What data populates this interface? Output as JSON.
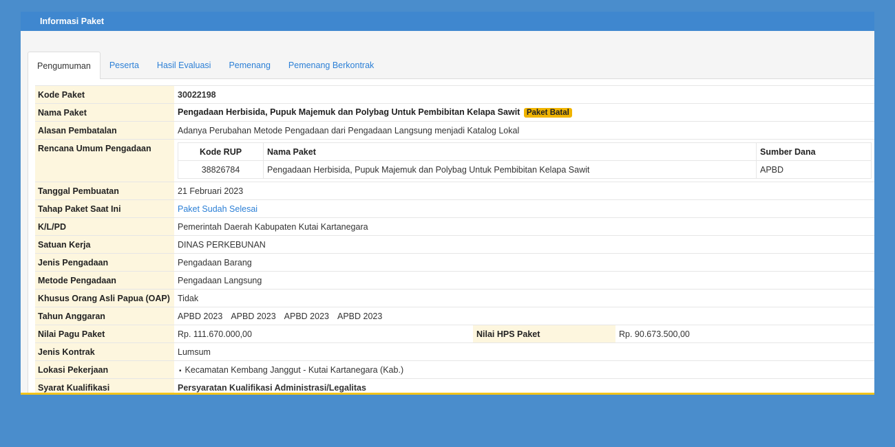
{
  "header": {
    "title": "Informasi Paket"
  },
  "tabs": [
    "Pengumuman",
    "Peserta",
    "Hasil Evaluasi",
    "Pemenang",
    "Pemenang Berkontrak"
  ],
  "rows": {
    "kode_paket": {
      "label": "Kode Paket",
      "value": "30022198"
    },
    "nama_paket": {
      "label": "Nama Paket",
      "value": "Pengadaan Herbisida, Pupuk Majemuk dan Polybag Untuk Pembibitan Kelapa Sawit",
      "badge": "Paket Batal"
    },
    "alasan": {
      "label": "Alasan Pembatalan",
      "value": "Adanya Perubahan Metode Pengadaan dari Pengadaan Langsung menjadi Katalog Lokal"
    },
    "rup": {
      "label": "Rencana Umum Pengadaan",
      "headers": {
        "kode": "Kode RUP",
        "nama": "Nama Paket",
        "sumber": "Sumber Dana"
      },
      "row": {
        "kode": "38826784",
        "nama": "Pengadaan Herbisida, Pupuk Majemuk dan Polybag Untuk Pembibitan Kelapa Sawit",
        "sumber": "APBD"
      }
    },
    "tanggal": {
      "label": "Tanggal Pembuatan",
      "value": "21 Februari 2023"
    },
    "tahap": {
      "label": "Tahap Paket Saat Ini",
      "value": "Paket Sudah Selesai"
    },
    "klpd": {
      "label": "K/L/PD",
      "value": "Pemerintah Daerah Kabupaten Kutai Kartanegara"
    },
    "satker": {
      "label": "Satuan Kerja",
      "value": "DINAS PERKEBUNAN"
    },
    "jenis": {
      "label": "Jenis Pengadaan",
      "value": "Pengadaan Barang"
    },
    "metode": {
      "label": "Metode Pengadaan",
      "value": "Pengadaan Langsung"
    },
    "oap": {
      "label": "Khusus Orang Asli Papua (OAP)",
      "value": "Tidak"
    },
    "tahun": {
      "label": "Tahun Anggaran",
      "values": [
        "APBD 2023",
        "APBD 2023",
        "APBD 2023",
        "APBD 2023"
      ]
    },
    "pagu": {
      "label": "Nilai Pagu Paket",
      "value": "Rp. 111.670.000,00",
      "hps_label": "Nilai HPS Paket",
      "hps_value": "Rp. 90.673.500,00"
    },
    "kontrak": {
      "label": "Jenis Kontrak",
      "value": "Lumsum"
    },
    "lokasi": {
      "label": "Lokasi Pekerjaan",
      "value": "Kecamatan Kembang Janggut - Kutai Kartanegara (Kab.)"
    },
    "syarat": {
      "label": "Syarat Kualifikasi",
      "value": "Persyaratan Kualifikasi Administrasi/Legalitas"
    }
  },
  "colors": {
    "header_blue": "#3f87cf",
    "label_bg": "#fdf6de",
    "badge": "#f0b400",
    "link": "#2b7fd6"
  }
}
